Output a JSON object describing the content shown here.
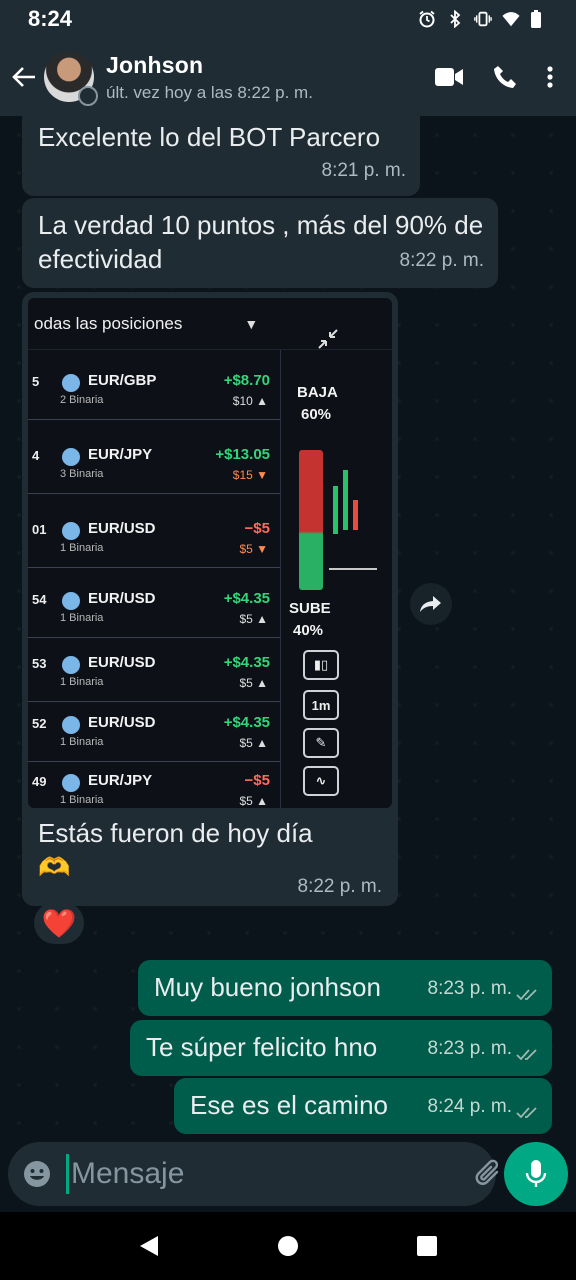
{
  "status_bar": {
    "time": "8:24",
    "icons": [
      "alarm-icon",
      "bluetooth-icon",
      "vibrate-icon",
      "wifi-icon",
      "battery-icon"
    ]
  },
  "header": {
    "contact_name": "Jonhson",
    "last_seen": "últ. vez hoy a las 8:22 p. m.",
    "actions": [
      "video-call-icon",
      "phone-icon",
      "more-icon"
    ]
  },
  "messages": [
    {
      "direction": "in",
      "text": "Excelente lo del BOT Parcero",
      "time": "8:21 p. m."
    },
    {
      "direction": "in",
      "text": "La verdad 10 puntos , más del 90% de efectividad",
      "time": "8:22 p. m."
    },
    {
      "direction": "in",
      "type": "image",
      "caption": "Estás fueron de hoy día",
      "caption_emoji": "🫶",
      "time": "8:22 p. m.",
      "reaction": "❤️",
      "screenshot": {
        "header": "odas las posiciones",
        "rows": [
          {
            "idx": "5",
            "pair": "EUR/GBP",
            "sub": "2 Binaria",
            "profit": "+$8.70",
            "stake": "$10 ▲",
            "dir": "up"
          },
          {
            "idx": "4",
            "pair": "EUR/JPY",
            "sub": "3 Binaria",
            "profit": "+$13.05",
            "stake": "$15 ▼",
            "dir": "up"
          },
          {
            "idx": "01",
            "pair": "EUR/USD",
            "sub": "1 Binaria",
            "profit": "−$5",
            "stake": "$5 ▼",
            "dir": "down"
          },
          {
            "idx": "54",
            "pair": "EUR/USD",
            "sub": "1 Binaria",
            "profit": "+$4.35",
            "stake": "$5 ▲",
            "dir": "up"
          },
          {
            "idx": "53",
            "pair": "EUR/USD",
            "sub": "1 Binaria",
            "profit": "+$4.35",
            "stake": "$5 ▲",
            "dir": "up"
          },
          {
            "idx": "52",
            "pair": "EUR/USD",
            "sub": "1 Binaria",
            "profit": "+$4.35",
            "stake": "$5 ▲",
            "dir": "up"
          },
          {
            "idx": "49",
            "pair": "EUR/JPY",
            "sub": "1 Binaria",
            "profit": "−$5",
            "stake": "$5 ▲",
            "dir": "down"
          }
        ],
        "panel": {
          "down_label": "BAJA",
          "down_pct": "60%",
          "up_label": "SUBE",
          "up_pct": "40%",
          "btn_time": "1m"
        }
      }
    },
    {
      "direction": "out",
      "text": "Muy bueno jonhson",
      "time": "8:23 p. m."
    },
    {
      "direction": "out",
      "text": "Te súper felicito hno",
      "time": "8:23 p. m."
    },
    {
      "direction": "out",
      "text": "Ese es el camino",
      "time": "8:24 p. m."
    }
  ],
  "composer": {
    "placeholder": "Mensaje"
  },
  "colors": {
    "background": "#0b141a",
    "incoming": "#202c33",
    "outgoing": "#005c4b",
    "accent": "#00a884"
  }
}
